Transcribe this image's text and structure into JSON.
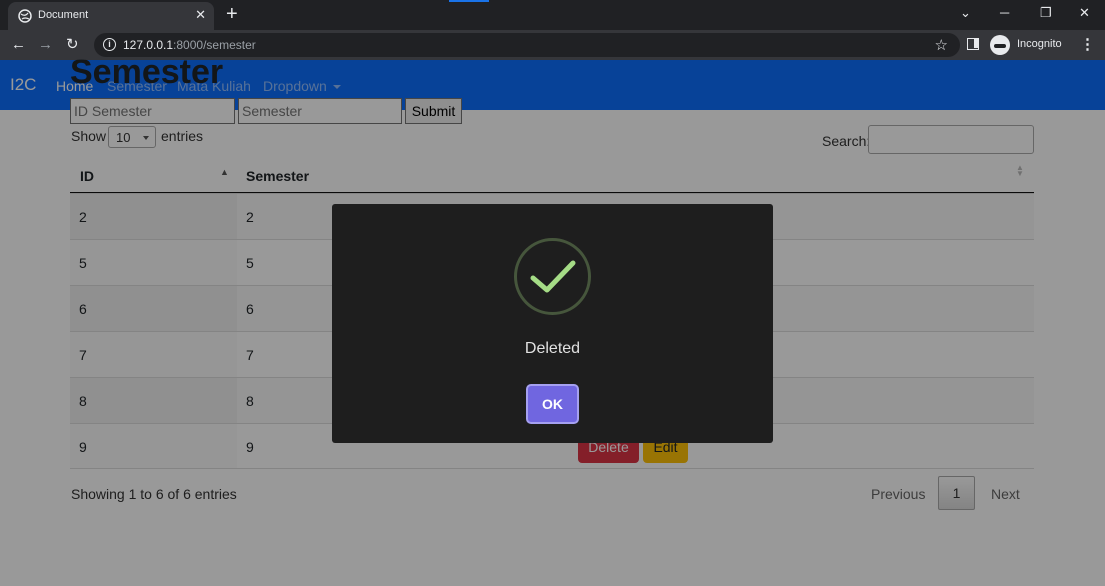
{
  "browser": {
    "tab_title": "Document",
    "tab_close": "✕",
    "new_tab": "+",
    "url_host": "127.0.0.1",
    "url_path": ":8000/semester",
    "incognito_label": "Incognito",
    "icons": {
      "back": "←",
      "forward": "→",
      "reload": "↻",
      "star": "☆",
      "menu": "⋮",
      "minimize": "─",
      "restore": "❐",
      "close": "✕",
      "tab_search": "⌄"
    }
  },
  "navbar": {
    "brand": "I2C",
    "links": [
      "Home",
      "Semester",
      "Mata Kuliah",
      "Dropdown"
    ]
  },
  "page": {
    "title": "Semester",
    "id_placeholder": "ID Semester",
    "semester_placeholder": "Semester",
    "submit_label": "Submit",
    "show_label": "Show",
    "entries_value": "10",
    "entries_label": "entries",
    "search_label": "Search:"
  },
  "table": {
    "headers": [
      "ID",
      "Semester"
    ],
    "rows": [
      {
        "id": "2",
        "semester": "2"
      },
      {
        "id": "5",
        "semester": "5"
      },
      {
        "id": "6",
        "semester": "6"
      },
      {
        "id": "7",
        "semester": "7"
      },
      {
        "id": "8",
        "semester": "8"
      },
      {
        "id": "9",
        "semester": "9"
      }
    ],
    "delete_label": "Delete",
    "edit_label": "Edit"
  },
  "footer": {
    "info": "Showing 1 to 6 of 6 entries",
    "previous": "Previous",
    "page": "1",
    "next": "Next"
  },
  "dialog": {
    "title": "Deleted",
    "ok_label": "OK",
    "icon": "success-check"
  },
  "colors": {
    "navbar": "#0d6efd",
    "delete": "#dc3545",
    "edit": "#ffc107",
    "ok": "#7066e0",
    "success": "#a5dc86"
  }
}
